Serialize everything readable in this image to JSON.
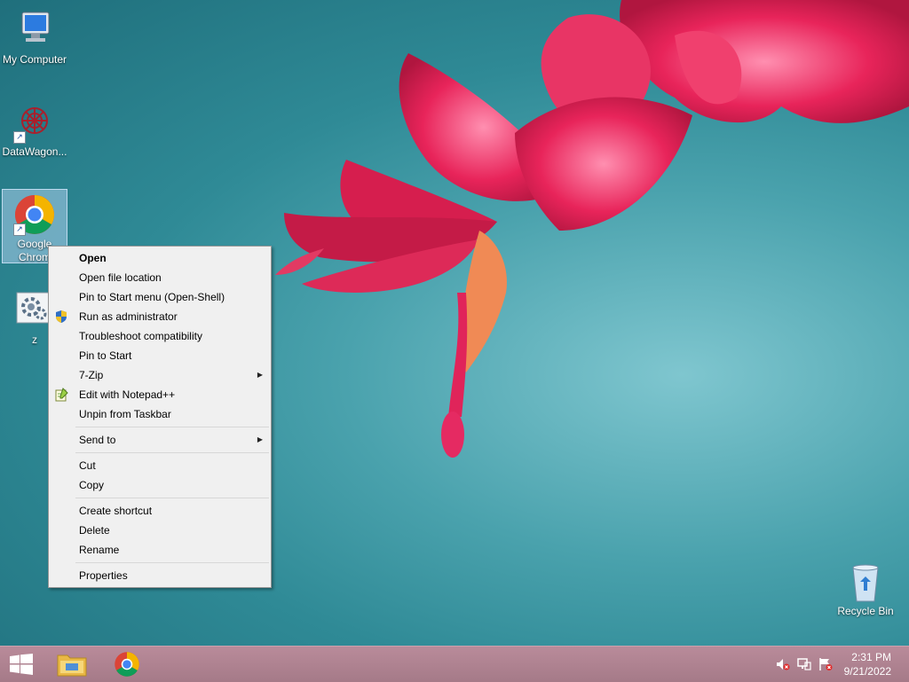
{
  "desktop": {
    "icons": [
      {
        "label": "My Computer"
      },
      {
        "label": "DataWagon..."
      },
      {
        "label_line1": "Google",
        "label_line2": "Chrom"
      },
      {
        "label": "z"
      },
      {
        "label": "Recycle Bin"
      }
    ]
  },
  "context_menu": {
    "items": {
      "open": "Open",
      "open_file_location": "Open file location",
      "pin_start_menu": "Pin to Start menu (Open-Shell)",
      "run_as_admin": "Run as administrator",
      "troubleshoot": "Troubleshoot compatibility",
      "pin_to_start": "Pin to Start",
      "seven_zip": "7-Zip",
      "edit_notepad": "Edit with Notepad++",
      "unpin_taskbar": "Unpin from Taskbar",
      "send_to": "Send to",
      "cut": "Cut",
      "copy": "Copy",
      "create_shortcut": "Create shortcut",
      "delete": "Delete",
      "rename": "Rename",
      "properties": "Properties"
    }
  },
  "taskbar": {
    "time": "2:31 PM",
    "date": "9/21/2022"
  },
  "icons": {
    "start": "windows-logo-icon",
    "explorer": "file-explorer-icon",
    "chrome": "chrome-icon",
    "volume": "volume-muted-icon",
    "network": "network-icon",
    "action_center": "action-center-flag-icon"
  }
}
